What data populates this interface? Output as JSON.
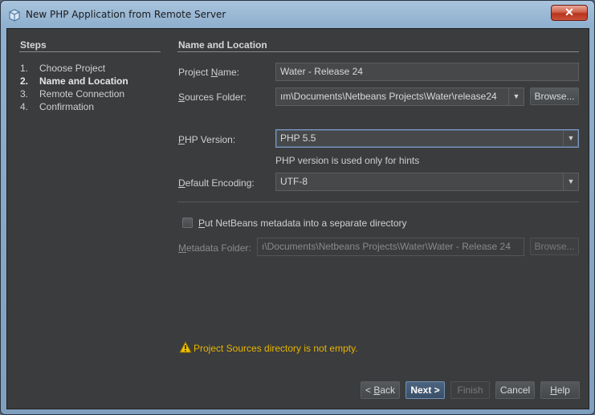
{
  "window": {
    "title": "New PHP Application from Remote Server",
    "close_glyph": "✕"
  },
  "steps": {
    "title": "Steps",
    "items": [
      {
        "num": "1.",
        "label": "Choose Project"
      },
      {
        "num": "2.",
        "label": "Name and Location"
      },
      {
        "num": "3.",
        "label": "Remote Connection"
      },
      {
        "num": "4.",
        "label": "Confirmation"
      }
    ],
    "active_index": 1
  },
  "content": {
    "title": "Name and Location",
    "project_name": {
      "label_pre": "Project ",
      "label_mn": "N",
      "label_post": "ame:",
      "value": "Water - Release 24"
    },
    "sources_folder": {
      "label_pre": "",
      "label_mn": "S",
      "label_post": "ources Folder:",
      "value": "ım\\Documents\\Netbeans Projects\\Water\\release24"
    },
    "browse_sources": "Browse...",
    "php_version": {
      "label_pre": "",
      "label_mn": "P",
      "label_post": "HP Version:",
      "value": "PHP 5.5"
    },
    "php_hint": "PHP version is used only for hints",
    "encoding": {
      "label_pre": "",
      "label_mn": "D",
      "label_post": "efault Encoding:",
      "value": "UTF-8"
    },
    "metadata_checkbox": {
      "label_mn": "P",
      "label_post": "ut NetBeans metadata into a separate directory",
      "checked": false
    },
    "metadata_folder": {
      "label_pre": "",
      "label_mn": "M",
      "label_post": "etadata Folder:",
      "value": "ı\\Documents\\Netbeans Projects\\Water\\Water - Release 24"
    },
    "browse_metadata": "Browse...",
    "warning": "Project Sources directory is not empty."
  },
  "buttons": {
    "back_pre": "< ",
    "back_mn": "B",
    "back_post": "ack",
    "next": "Next >",
    "finish": "Finish",
    "cancel": "Cancel",
    "help_mn": "H",
    "help_post": "elp"
  },
  "colors": {
    "background": "#3a3c3e",
    "warning": "#e8b400",
    "focus_border": "#7d9bc0"
  }
}
